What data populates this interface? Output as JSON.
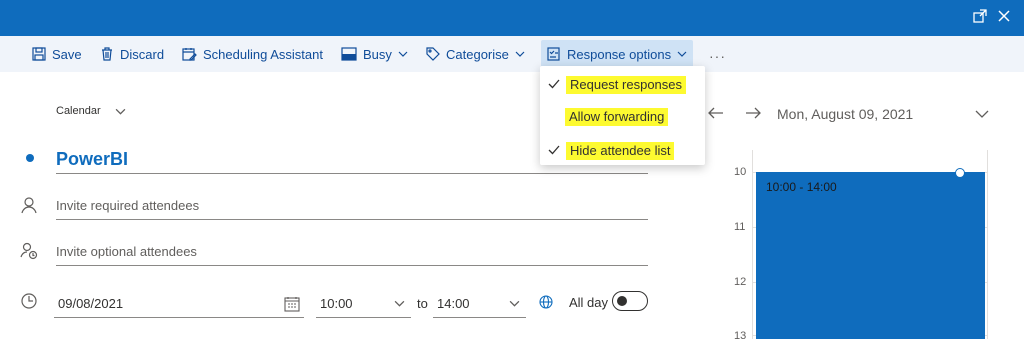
{
  "window": {
    "popout_icon": "popout-icon",
    "close_icon": "close-icon"
  },
  "toolbar": {
    "save": "Save",
    "discard": "Discard",
    "scheduling": "Scheduling Assistant",
    "busy": "Busy",
    "categorise": "Categorise",
    "response_options": "Response options",
    "more": "···"
  },
  "response_menu": {
    "items": [
      {
        "label": "Request responses",
        "checked": true
      },
      {
        "label": "Allow forwarding",
        "checked": false
      },
      {
        "label": "Hide attendee list",
        "checked": true
      }
    ]
  },
  "form": {
    "calendar_label": "Calendar",
    "title": "PowerBI",
    "required_placeholder": "Invite required attendees",
    "optional_placeholder": "Invite optional attendees",
    "date": "09/08/2021",
    "start_time": "10:00",
    "to_label": "to",
    "end_time": "14:00",
    "all_day_label": "All day",
    "all_day": false
  },
  "day_view": {
    "date_heading": "Mon, August 09, 2021",
    "hours": [
      "10",
      "11",
      "12",
      "13"
    ],
    "event_time": "10:00 - 14:00"
  },
  "colors": {
    "accent": "#0f6cbd",
    "highlight": "#fdfa30",
    "toolbar_bg": "#f0f4fa"
  }
}
